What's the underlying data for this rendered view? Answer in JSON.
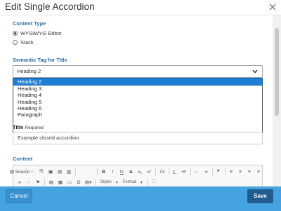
{
  "modal": {
    "title": "Edit Single Accordion",
    "close_icon": "close-icon"
  },
  "content_type": {
    "label": "Content Type",
    "options": [
      {
        "label": "WYSIWYG Editor",
        "checked": true
      },
      {
        "label": "Stack",
        "checked": false
      }
    ]
  },
  "semantic_tag": {
    "label": "Semantic Tag for Title",
    "selected": "Heading 2",
    "options": [
      "Heading 2",
      "Heading 3",
      "Heading 4",
      "Heading 5",
      "Heading 6",
      "Paragraph"
    ]
  },
  "title_field": {
    "label": "Title",
    "required_text": "Required",
    "value": "Example closed accordion"
  },
  "content_field": {
    "label": "Content",
    "toolbar_row1": [
      "Source",
      "Cut",
      "Copy",
      "Paste",
      "Paste as text",
      "Paste from Word",
      "Undo",
      "Redo",
      "B",
      "I",
      "U",
      "S",
      "x₂",
      "x²",
      "Tx",
      "Numbered list",
      "Bulleted list",
      "Decrease indent",
      "Increase indent",
      "Blockquote",
      "Align left",
      "Align center",
      "Align right",
      "Justify"
    ],
    "toolbar_row2": [
      "Link",
      "Unlink",
      "Anchor",
      "Image",
      "Table",
      "Horizontal line",
      "Ω",
      "Templates",
      "Styles",
      "Format",
      "Maximize"
    ],
    "source_label": "Source",
    "styles_label": "Styles",
    "format_label": "Format"
  },
  "footer": {
    "cancel_label": "Cancel",
    "save_label": "Save"
  },
  "colors": {
    "accent": "#2b6ea6",
    "footer": "#45a3e0",
    "save": "#225c8e",
    "selection": "#1e7fd6"
  }
}
